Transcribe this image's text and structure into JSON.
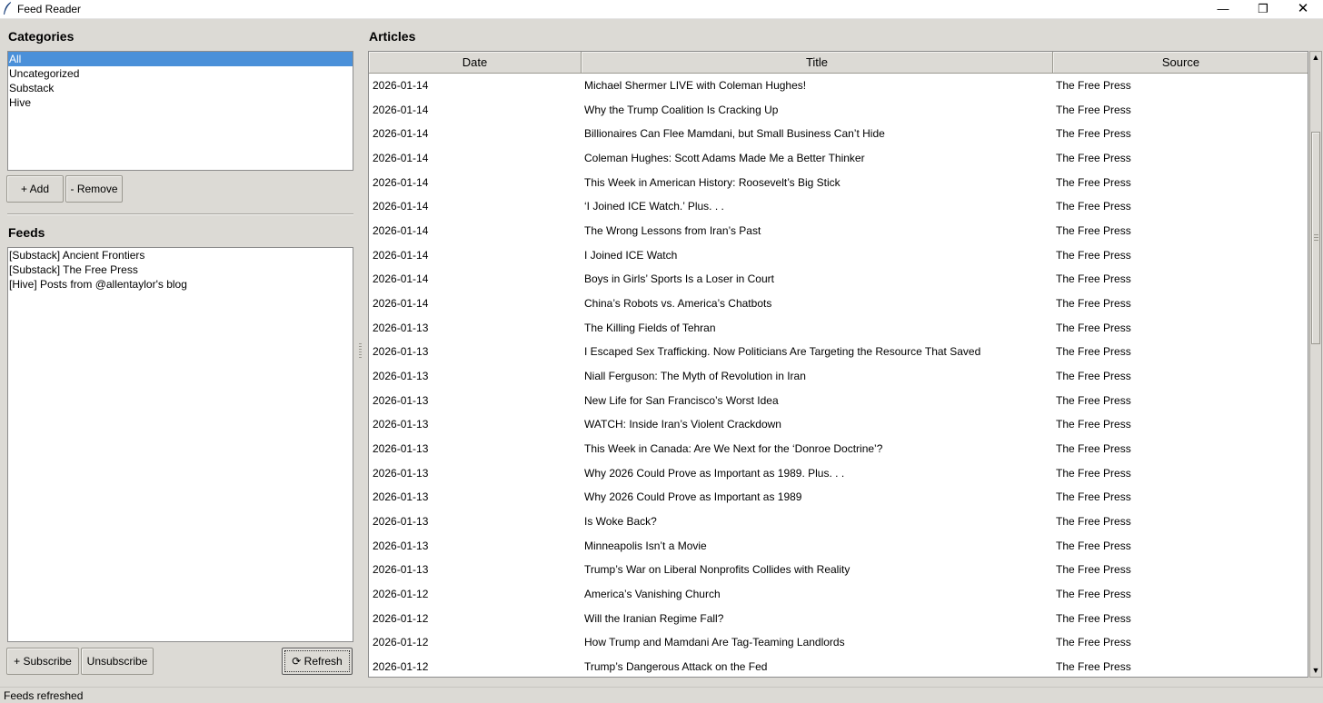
{
  "window": {
    "title": "Feed Reader",
    "minimize_glyph": "—",
    "maximize_glyph": "❐",
    "close_glyph": "✕"
  },
  "categories": {
    "heading": "Categories",
    "items": [
      "All",
      "Uncategorized",
      "Substack",
      "Hive"
    ],
    "selected_index": 0,
    "add_label": "+ Add",
    "remove_label": "- Remove"
  },
  "feeds": {
    "heading": "Feeds",
    "items": [
      "[Substack] Ancient Frontiers",
      "[Substack] The Free Press",
      "[Hive] Posts from @allentaylor's blog"
    ],
    "subscribe_label": "+ Subscribe",
    "unsubscribe_label": "Unsubscribe",
    "refresh_label": "⟳ Refresh"
  },
  "articles": {
    "heading": "Articles",
    "columns": [
      "Date",
      "Title",
      "Source"
    ],
    "rows": [
      [
        "2026-01-14",
        "Michael Shermer LIVE with Coleman Hughes!",
        "The Free Press"
      ],
      [
        "2026-01-14",
        "Why the Trump Coalition Is Cracking Up",
        "The Free Press"
      ],
      [
        "2026-01-14",
        "Billionaires Can Flee Mamdani, but Small Business Can’t Hide",
        "The Free Press"
      ],
      [
        "2026-01-14",
        "Coleman Hughes: Scott Adams Made Me a Better Thinker",
        "The Free Press"
      ],
      [
        "2026-01-14",
        "This Week in American History: Roosevelt’s Big Stick",
        "The Free Press"
      ],
      [
        "2026-01-14",
        "‘I Joined ICE Watch.’ Plus. . .",
        "The Free Press"
      ],
      [
        "2026-01-14",
        "The Wrong Lessons from Iran’s Past",
        "The Free Press"
      ],
      [
        "2026-01-14",
        "I Joined ICE Watch",
        "The Free Press"
      ],
      [
        "2026-01-14",
        "Boys in Girls’ Sports Is a Loser in Court",
        "The Free Press"
      ],
      [
        "2026-01-14",
        "China’s Robots vs. America’s Chatbots",
        "The Free Press"
      ],
      [
        "2026-01-13",
        "The Killing Fields of Tehran",
        "The Free Press"
      ],
      [
        "2026-01-13",
        "I Escaped Sex Trafficking. Now Politicians Are Targeting the Resource That Saved",
        "The Free Press"
      ],
      [
        "2026-01-13",
        "Niall Ferguson: The Myth of Revolution in Iran",
        "The Free Press"
      ],
      [
        "2026-01-13",
        "New Life for San Francisco’s Worst Idea",
        "The Free Press"
      ],
      [
        "2026-01-13",
        "WATCH: Inside Iran’s Violent Crackdown",
        "The Free Press"
      ],
      [
        "2026-01-13",
        "This Week in Canada: Are We Next for the ‘Donroe Doctrine’?",
        "The Free Press"
      ],
      [
        "2026-01-13",
        "Why 2026 Could Prove as Important as 1989. Plus. . .",
        "The Free Press"
      ],
      [
        "2026-01-13",
        "Why 2026 Could Prove as Important as 1989",
        "The Free Press"
      ],
      [
        "2026-01-13",
        "Is Woke Back?",
        "The Free Press"
      ],
      [
        "2026-01-13",
        "Minneapolis Isn’t a Movie",
        "The Free Press"
      ],
      [
        "2026-01-13",
        "Trump’s War on Liberal Nonprofits Collides with Reality",
        "The Free Press"
      ],
      [
        "2026-01-12",
        "America’s Vanishing Church",
        "The Free Press"
      ],
      [
        "2026-01-12",
        "Will the Iranian Regime Fall?",
        "The Free Press"
      ],
      [
        "2026-01-12",
        "How Trump and Mamdani Are Tag-Teaming Landlords",
        "The Free Press"
      ],
      [
        "2026-01-12",
        "Trump’s Dangerous Attack on the Fed",
        "The Free Press"
      ]
    ]
  },
  "status": {
    "text": "Feeds refreshed"
  },
  "colors": {
    "selection": "#4a90d9",
    "background": "#dcdad5"
  }
}
